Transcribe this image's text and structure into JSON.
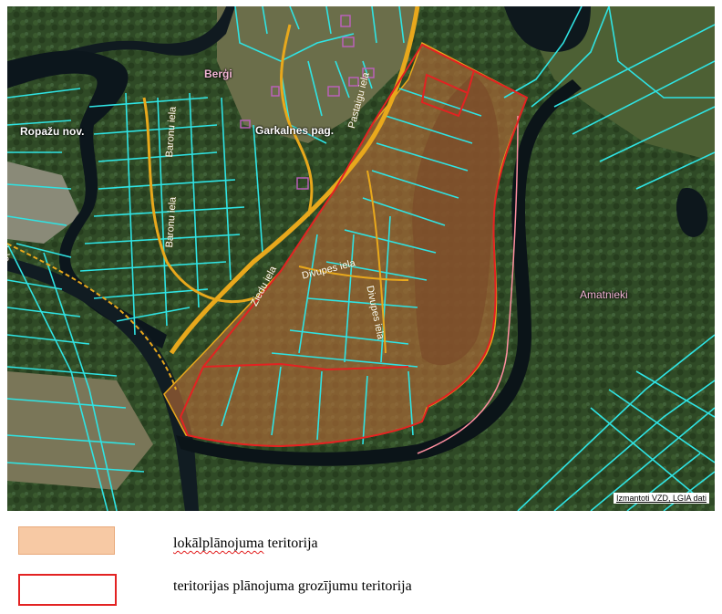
{
  "map": {
    "place_labels": {
      "ropazu": "Ropažu nov.",
      "bergi": "Berģi",
      "garkalnes": "Garkalnes pag.",
      "amatnieki": "Amatnieki"
    },
    "street_labels": {
      "baronu_1": "Baronu iela",
      "baronu_2": "Baronu iela",
      "ziedu": "Ziedu iela",
      "divupes_1": "Divupes iela",
      "divupes_2": "Divupes iela",
      "pastaigu": "Pastaigu iela",
      "edge": "iela"
    },
    "credit": "Izmantoti VZD, LGIA dati"
  },
  "legend": {
    "items": [
      {
        "first_word": "lokālplānojuma",
        "rest": " teritorija"
      },
      {
        "text": "teritorijas plānojuma grozījumu teritorija"
      }
    ]
  },
  "colors": {
    "local_plan_fill": "#f7c9a4",
    "amendment_outline": "#e32222",
    "parcel_lines": "#2fe3e3",
    "road": "#e8a81c"
  }
}
